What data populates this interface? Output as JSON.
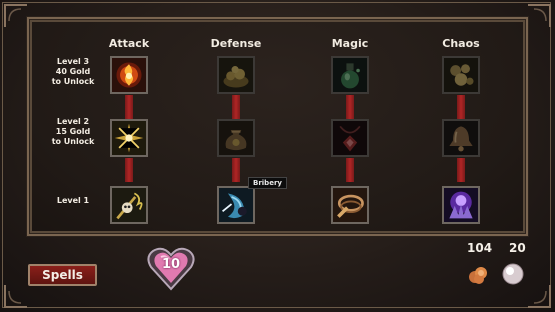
{
  "columns": {
    "attack": "Attack",
    "defense": "Defense",
    "magic": "Magic",
    "chaos": "Chaos"
  },
  "rows": {
    "level3": {
      "line1": "Level 3",
      "line2": "40 Gold",
      "line3": "to Unlock"
    },
    "level2": {
      "line1": "Level 2",
      "line2": "15 Gold",
      "line3": "to Unlock"
    },
    "level1": {
      "line1": "Level 1"
    }
  },
  "tooltip": "Bribery",
  "spells_button": "Spells",
  "heart_count": "10",
  "resources": {
    "gold": "104",
    "pearls": "20"
  },
  "icons": {
    "attack_l3": "fire-orb-icon",
    "attack_l2": "sparkle-burst-icon",
    "attack_l1": "skull-scepter-icon",
    "defense_l3": "gold-pile-icon",
    "defense_l2": "coin-sack-icon",
    "defense_l1": "blue-crescent-icon",
    "magic_l3": "potion-icon",
    "magic_l2": "red-amulet-icon",
    "magic_l1": "chain-whip-icon",
    "chaos_l3": "coins-icon",
    "chaos_l2": "bell-icon",
    "chaos_l1": "purple-summon-icon"
  },
  "colors": {
    "connector": "#b02525",
    "spells_button": "#8a1f1a",
    "heart": "#e07ab0"
  }
}
